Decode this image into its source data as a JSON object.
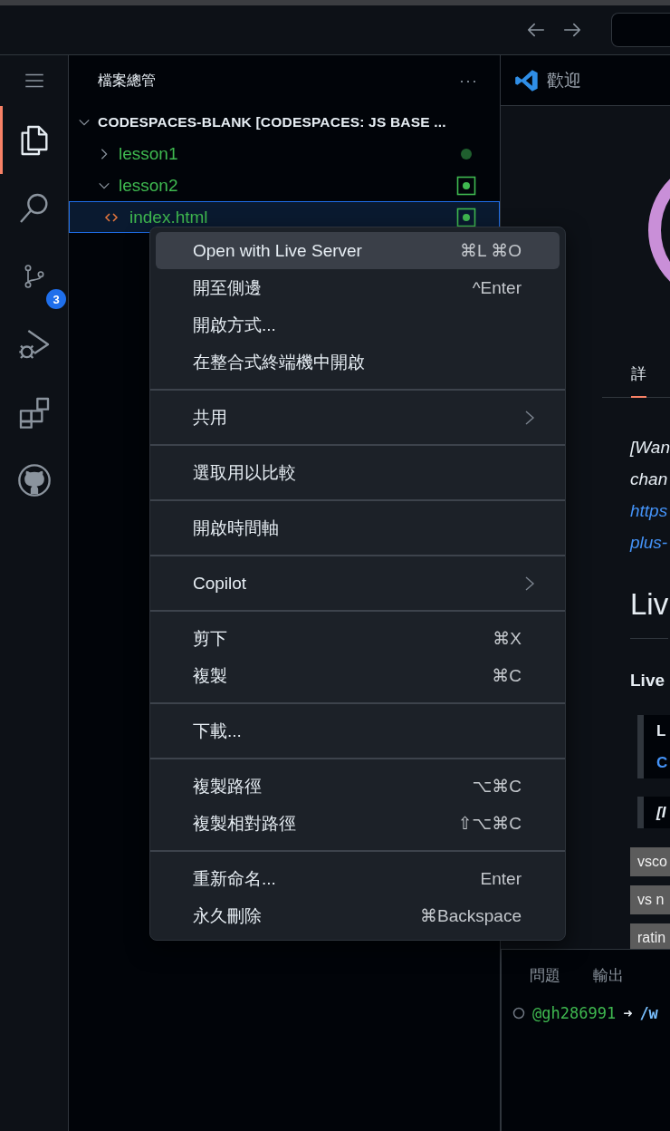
{
  "activity_bar": {
    "items": [
      {
        "kind": "menu",
        "selected": false
      },
      {
        "kind": "explorer",
        "selected": true
      },
      {
        "kind": "search",
        "selected": false
      },
      {
        "kind": "source-control",
        "selected": false,
        "badge": "3"
      },
      {
        "kind": "run-debug",
        "selected": false
      },
      {
        "kind": "extensions",
        "selected": false
      },
      {
        "kind": "github",
        "selected": false
      }
    ]
  },
  "sidebar": {
    "title": "檔案總管",
    "actions": "···",
    "tree": [
      {
        "kind": "root",
        "label": "CODESPACES-BLANK [CODESPACES: JS BASE ...",
        "expanded": true,
        "selected": false,
        "children": [
          {
            "kind": "folder",
            "label": "lesson1",
            "expanded": false,
            "selected": false,
            "modified": true,
            "boxed": false
          },
          {
            "kind": "folder",
            "label": "lesson2",
            "expanded": true,
            "selected": false,
            "modified": true,
            "boxed": true,
            "children": [
              {
                "kind": "file",
                "label": "index.html",
                "selected": true,
                "modified": true,
                "boxed": true
              }
            ]
          }
        ]
      }
    ]
  },
  "context_menu": {
    "groups": [
      [
        {
          "label": "Open with Live Server",
          "shortcut": "⌘L ⌘O",
          "selected": true,
          "submenu": false
        },
        {
          "label": "開至側邊",
          "shortcut": "^Enter",
          "selected": false,
          "submenu": false
        },
        {
          "label": "開啟方式...",
          "selected": false,
          "submenu": false
        },
        {
          "label": "在整合式終端機中開啟",
          "selected": false,
          "submenu": false
        }
      ],
      [
        {
          "label": "共用",
          "selected": false,
          "submenu": true
        }
      ],
      [
        {
          "label": "選取用以比較",
          "selected": false,
          "submenu": false
        }
      ],
      [
        {
          "label": "開啟時間軸",
          "selected": false,
          "submenu": false
        }
      ],
      [
        {
          "label": "Copilot",
          "selected": false,
          "submenu": true
        }
      ],
      [
        {
          "label": "剪下",
          "shortcut": "⌘X",
          "selected": false,
          "submenu": false
        },
        {
          "label": "複製",
          "shortcut": "⌘C",
          "selected": false,
          "submenu": false
        }
      ],
      [
        {
          "label": "下載...",
          "selected": false,
          "submenu": false
        }
      ],
      [
        {
          "label": "複製路徑",
          "shortcut": "⌥⌘C",
          "selected": false,
          "submenu": false
        },
        {
          "label": "複製相對路徑",
          "shortcut": "⇧⌥⌘C",
          "selected": false,
          "submenu": false
        }
      ],
      [
        {
          "label": "重新命名...",
          "shortcut": "Enter",
          "selected": false,
          "submenu": false
        },
        {
          "label": "永久刪除",
          "shortcut": "⌘Backspace",
          "selected": false,
          "submenu": false
        }
      ]
    ]
  },
  "editor": {
    "tab": {
      "label": "歡迎",
      "selected": true
    },
    "detail_tabs": [
      {
        "label": "詳",
        "selected": true
      }
    ],
    "blocks": [
      {
        "kind": "note",
        "text": "[Wan"
      },
      {
        "kind": "note",
        "text": "chan"
      },
      {
        "kind": "link",
        "text": "https"
      },
      {
        "kind": "link",
        "text": "plus-"
      },
      {
        "kind": "heading",
        "text": "Liv"
      },
      {
        "kind": "bold",
        "text": "Live"
      },
      {
        "kind": "quote",
        "lines": [
          {
            "kind": "bold",
            "text": "L"
          },
          {
            "kind": "link",
            "text": "C"
          }
        ]
      },
      {
        "kind": "quote",
        "lines": [
          {
            "kind": "bold-italic",
            "text": "[I"
          }
        ]
      },
      {
        "kind": "tag",
        "text": "vsco"
      },
      {
        "kind": "tag",
        "text": "vs n"
      },
      {
        "kind": "tag",
        "text": "ratin"
      }
    ]
  },
  "panel": {
    "tabs": [
      {
        "label": "問題",
        "selected": false
      },
      {
        "label": "輸出",
        "selected": false
      }
    ],
    "terminal": {
      "user": "@gh286991",
      "arrow": "➜",
      "path": "/w"
    }
  }
}
